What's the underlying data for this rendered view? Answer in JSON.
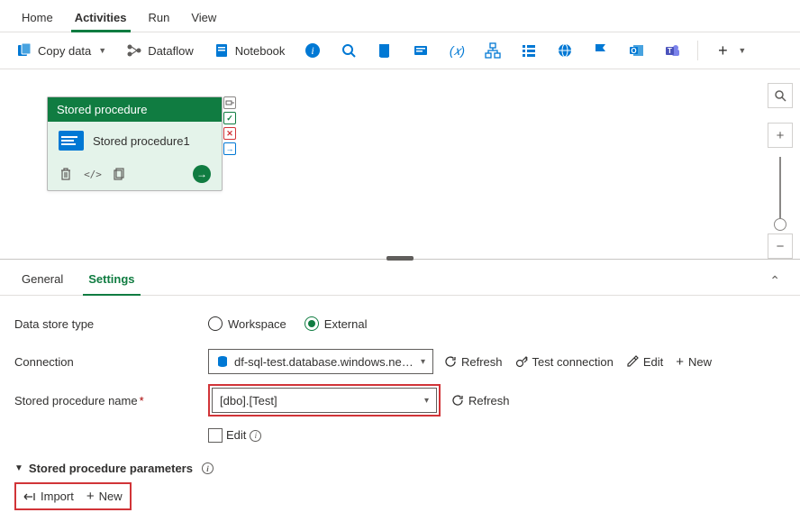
{
  "topTabs": {
    "home": "Home",
    "activities": "Activities",
    "run": "Run",
    "view": "View"
  },
  "toolbar": {
    "copyData": "Copy data",
    "dataflow": "Dataflow",
    "notebook": "Notebook"
  },
  "activity": {
    "type": "Stored procedure",
    "name": "Stored procedure1"
  },
  "lowerTabs": {
    "general": "General",
    "settings": "Settings"
  },
  "form": {
    "dataStoreType": {
      "label": "Data store type",
      "workspace": "Workspace",
      "external": "External"
    },
    "connection": {
      "label": "Connection",
      "value": "df-sql-test.database.windows.net;tes…",
      "refresh": "Refresh",
      "testConn": "Test connection",
      "edit": "Edit",
      "new": "New"
    },
    "spName": {
      "label": "Stored procedure name",
      "value": "[dbo].[Test]",
      "refresh": "Refresh",
      "editChk": "Edit"
    },
    "params": {
      "label": "Stored procedure parameters",
      "import": "Import",
      "new": "New"
    }
  }
}
